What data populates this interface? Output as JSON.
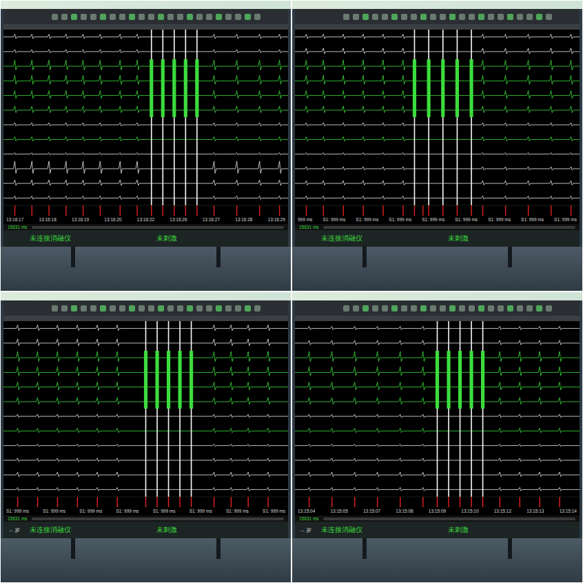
{
  "panels": [
    {
      "name": "photo-top-left",
      "counter": "15631 ms",
      "age": "",
      "status_left": "未连接消融仪",
      "status_right": "未刺激",
      "ruler": [
        "13:16:17",
        "13:16:18",
        "13:16:19",
        "13:16:20",
        "13:16:22",
        "13:16:26",
        "13:16:27",
        "13:16:28",
        "13:16:29"
      ],
      "beats": [
        0.04,
        0.1,
        0.16,
        0.22,
        0.28,
        0.34,
        0.41,
        0.47,
        0.74,
        0.82,
        0.9,
        0.97
      ],
      "burst": [
        0.52,
        0.56,
        0.6,
        0.64,
        0.68
      ],
      "channels": [
        {
          "color": "#e8e8e8",
          "amp": 4
        },
        {
          "color": "#e8e8e8",
          "amp": 3
        },
        {
          "color": "#3cdc3c",
          "amp": 9
        },
        {
          "color": "#3cdc3c",
          "amp": 8
        },
        {
          "color": "#3cdc3c",
          "amp": 7
        },
        {
          "color": "#3cdc3c",
          "amp": 6
        },
        {
          "color": "#e8e8e8",
          "amp": 3
        },
        {
          "color": "#3cdc3c",
          "amp": 4
        },
        {
          "color": "#e8e8e8",
          "amp": 2
        },
        {
          "color": "#e8e8e8",
          "amp": 11
        },
        {
          "color": "#e8e8e8",
          "amp": 5
        },
        {
          "color": "#e8e8e8",
          "amp": 3
        }
      ]
    },
    {
      "name": "photo-top-right",
      "counter": "15631 ms",
      "age": "",
      "status_left": "未连接消融仪",
      "status_right": "未刺激",
      "ruler": [
        "999 ms",
        "S1: 999 ms",
        "S1: 999 ms",
        "S1: 999 ms",
        "S1: 999 ms",
        "S1: 999 ms",
        "S1: 999 ms",
        "S1: 999 ms",
        "S1: 999 ms"
      ],
      "beats": [
        0.04,
        0.1,
        0.17,
        0.24,
        0.31,
        0.38,
        0.45,
        0.66,
        0.74,
        0.82,
        0.9,
        0.97
      ],
      "burst": [
        0.42,
        0.47,
        0.52,
        0.57,
        0.62
      ],
      "channels": [
        {
          "color": "#e8e8e8",
          "amp": 4
        },
        {
          "color": "#e8e8e8",
          "amp": 5
        },
        {
          "color": "#3cdc3c",
          "amp": 9
        },
        {
          "color": "#3cdc3c",
          "amp": 8
        },
        {
          "color": "#3cdc3c",
          "amp": 7
        },
        {
          "color": "#3cdc3c",
          "amp": 6
        },
        {
          "color": "#e8e8e8",
          "amp": 3
        },
        {
          "color": "#3cdc3c",
          "amp": 4
        },
        {
          "color": "#e8e8e8",
          "amp": 2
        },
        {
          "color": "#e8e8e8",
          "amp": 3
        },
        {
          "color": "#e8e8e8",
          "amp": 4
        },
        {
          "color": "#e8e8e8",
          "amp": 3
        }
      ]
    },
    {
      "name": "photo-bottom-left",
      "counter": "15631 ms",
      "age": "-- 岁",
      "status_left": "未连接消融仪",
      "status_right": "未刺激",
      "ruler": [
        "S1: 999 ms",
        "S1: 999 ms",
        "S1: 999 ms",
        "S1: 999 ms",
        "S1: 999 ms",
        "S1: 999 ms",
        "S1: 999 ms",
        "S1: 999 ms"
      ],
      "beats": [
        0.05,
        0.12,
        0.19,
        0.26,
        0.33,
        0.4,
        0.74,
        0.8,
        0.86,
        0.93
      ],
      "burst": [
        0.5,
        0.54,
        0.58,
        0.62,
        0.66
      ],
      "channels": [
        {
          "color": "#e8e8e8",
          "amp": 5
        },
        {
          "color": "#e8e8e8",
          "amp": 6
        },
        {
          "color": "#3cdc3c",
          "amp": 9
        },
        {
          "color": "#3cdc3c",
          "amp": 8
        },
        {
          "color": "#3cdc3c",
          "amp": 7
        },
        {
          "color": "#3cdc3c",
          "amp": 6
        },
        {
          "color": "#e8e8e8",
          "amp": 3
        },
        {
          "color": "#3cdc3c",
          "amp": 4
        },
        {
          "color": "#e8e8e8",
          "amp": 2
        },
        {
          "color": "#e8e8e8",
          "amp": 3
        },
        {
          "color": "#e8e8e8",
          "amp": 4
        },
        {
          "color": "#e8e8e8",
          "amp": 3
        }
      ]
    },
    {
      "name": "photo-bottom-right",
      "counter": "15631 ms",
      "age": "-- 岁",
      "status_left": "未连接消融仪",
      "status_right": "未刺激",
      "ruler": [
        "13:15:04",
        "13:15:05",
        "13:15:07",
        "13:15:08",
        "13:15:09",
        "13:15:10",
        "13:15:12",
        "13:15:13",
        "13:15:14"
      ],
      "beats": [
        0.05,
        0.13,
        0.21,
        0.29,
        0.37,
        0.45,
        0.72,
        0.79,
        0.86,
        0.93
      ],
      "burst": [
        0.5,
        0.54,
        0.58,
        0.62,
        0.66
      ],
      "channels": [
        {
          "color": "#e8e8e8",
          "amp": 3
        },
        {
          "color": "#e8e8e8",
          "amp": 4
        },
        {
          "color": "#3cdc3c",
          "amp": 9
        },
        {
          "color": "#3cdc3c",
          "amp": 8
        },
        {
          "color": "#3cdc3c",
          "amp": 7
        },
        {
          "color": "#3cdc3c",
          "amp": 6
        },
        {
          "color": "#e8e8e8",
          "amp": 3
        },
        {
          "color": "#3cdc3c",
          "amp": 4
        },
        {
          "color": "#e8e8e8",
          "amp": 2
        },
        {
          "color": "#e8e8e8",
          "amp": 3
        },
        {
          "color": "#e8e8e8",
          "amp": 4
        },
        {
          "color": "#e8e8e8",
          "amp": 3
        }
      ]
    }
  ]
}
